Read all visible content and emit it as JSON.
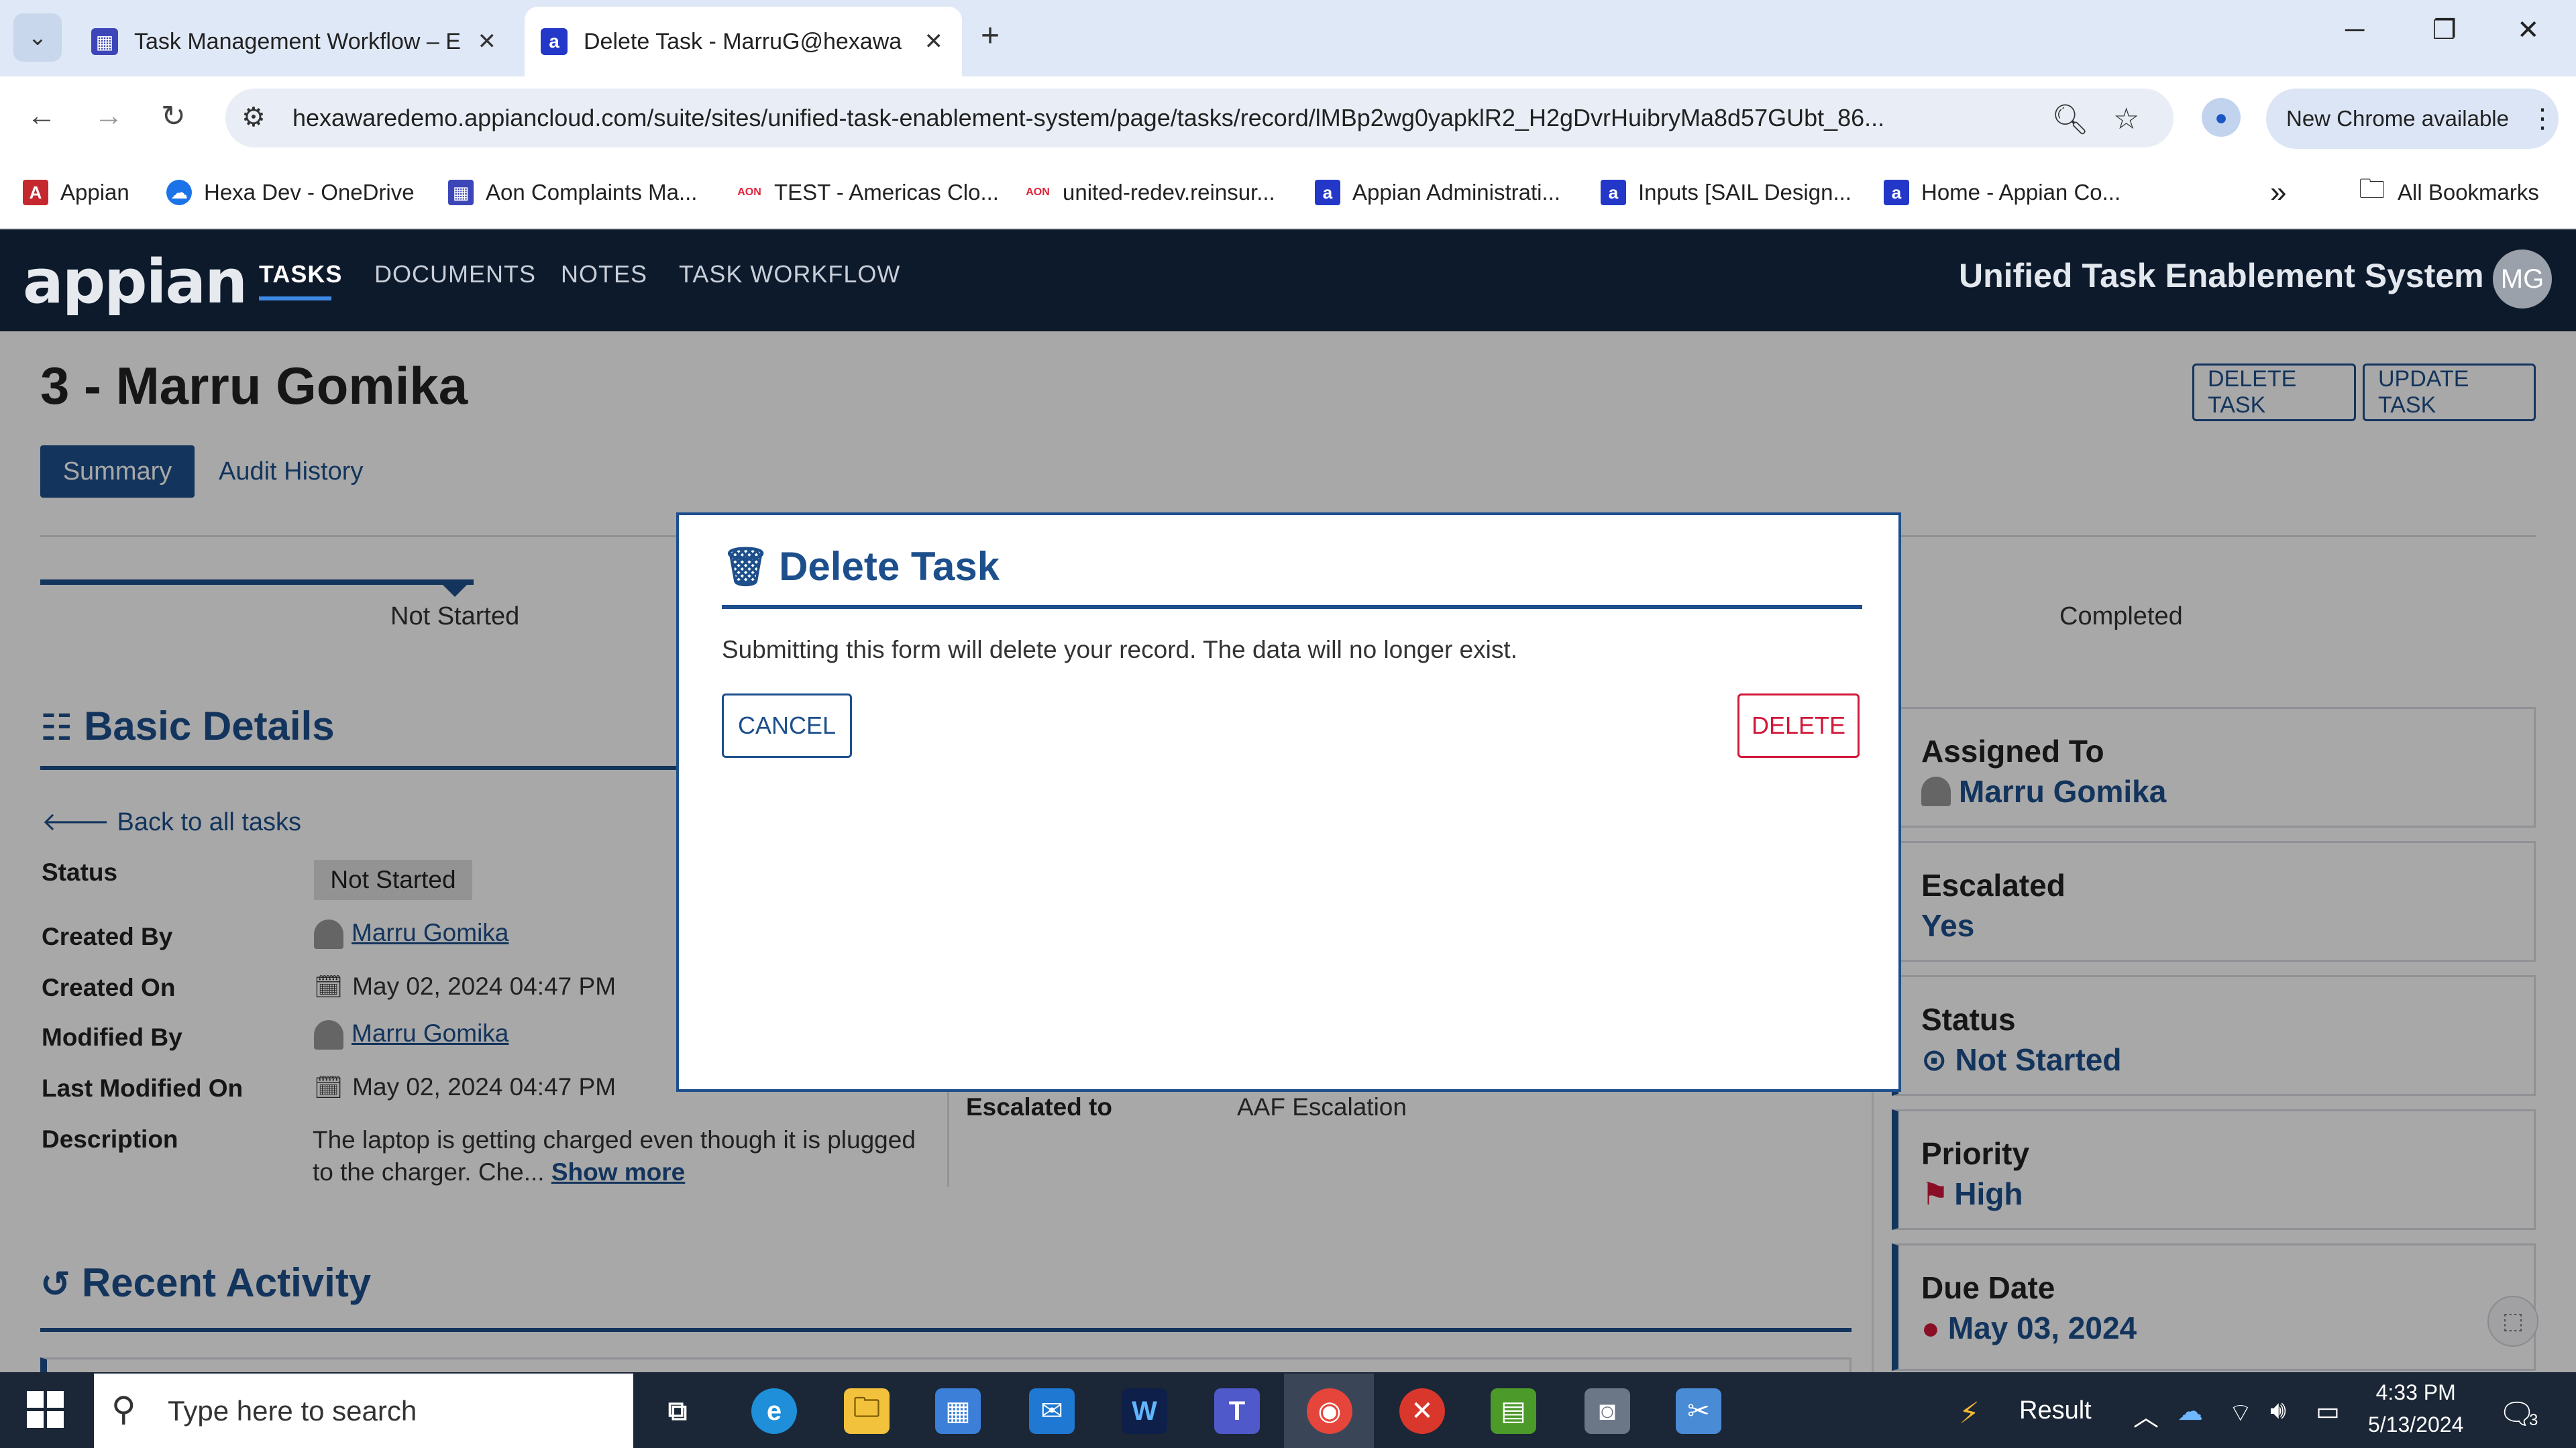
{
  "browser": {
    "tabs": [
      {
        "title": "Task Management Workflow – E",
        "icon_color": "#3c46b8"
      },
      {
        "title": "Delete Task - MarruG@hexawa",
        "icon_color": "#2338c9"
      }
    ],
    "url": "hexawaredemo.appiancloud.com/suite/sites/unified-task-enablement-system/page/tasks/record/lMBp2wg0yapklR2_H2gDvrHuibryMa8d57GUbt_86...",
    "new_chrome": "New Chrome available",
    "bookmarks": [
      {
        "label": "Appian",
        "icon": "A",
        "color": "#c5282f"
      },
      {
        "label": "Hexa Dev - OneDrive",
        "icon": "cloud",
        "color": "#1b73e8"
      },
      {
        "label": "Aon Complaints Ma...",
        "icon": "grid",
        "color": "#3c46b8"
      },
      {
        "label": "TEST - Americas Clo...",
        "icon": "AON",
        "color": "#e0223b"
      },
      {
        "label": "united-redev.reinsur...",
        "icon": "AON",
        "color": "#e0223b"
      },
      {
        "label": "Appian Administrati...",
        "icon": "a",
        "color": "#2338c9"
      },
      {
        "label": "Inputs [SAIL Design...",
        "icon": "a",
        "color": "#2338c9"
      },
      {
        "label": "Home - Appian Co...",
        "icon": "a",
        "color": "#2338c9"
      }
    ],
    "more_bookmarks": "»",
    "all_bookmarks": "All Bookmarks"
  },
  "app": {
    "logo": "appian",
    "nav": [
      "TASKS",
      "DOCUMENTS",
      "NOTES",
      "TASK WORKFLOW"
    ],
    "site_name": "Unified Task Enablement System",
    "avatar": "MG"
  },
  "record": {
    "title": "3 - Marru Gomika",
    "actions": {
      "delete": "DELETE TASK",
      "update": "UPDATE TASK"
    },
    "tabs": {
      "summary": "Summary",
      "audit": "Audit History"
    },
    "stages": {
      "first": "Not Started",
      "last": "Completed"
    },
    "basic_details": {
      "heading": "Basic Details",
      "back_link": "Back to all tasks",
      "status_label": "Status",
      "status_value": "Not Started",
      "created_by_label": "Created By",
      "created_by": "Marru Gomika",
      "created_on_label": "Created On",
      "created_on": "May 02, 2024 04:47 PM",
      "modified_by_label": "Modified By",
      "modified_by": "Marru Gomika",
      "last_modified_label": "Last Modified On",
      "last_modified": "May 02, 2024 04:47 PM",
      "description_label": "Description",
      "description": "The laptop is getting charged even though it is plugged to the charger. Che...",
      "show_more": "Show more",
      "escalated_to_label": "Escalated to",
      "escalated_to": "AAF Escalation"
    },
    "recent_activity": "Recent Activity",
    "side_cards": [
      {
        "label": "Assigned To",
        "value": "Marru Gomika"
      },
      {
        "label": "Escalated",
        "value": "Yes"
      },
      {
        "label": "Status",
        "value": "Not Started"
      },
      {
        "label": "Priority",
        "value": "High"
      },
      {
        "label": "Due Date",
        "value": "May 03, 2024"
      }
    ]
  },
  "modal": {
    "title": "Delete Task",
    "message": "Submitting this form will delete your record. The data will no longer exist.",
    "cancel": "CANCEL",
    "delete": "DELETE"
  },
  "taskbar": {
    "search_placeholder": "Type here to search",
    "tray_label": "Result",
    "time": "4:33 PM",
    "date": "5/13/2024",
    "notifications": "3"
  },
  "colors": {
    "primary": "#1d4f8c",
    "danger": "#d2173a",
    "nav_bg": "#0d1a2b"
  }
}
